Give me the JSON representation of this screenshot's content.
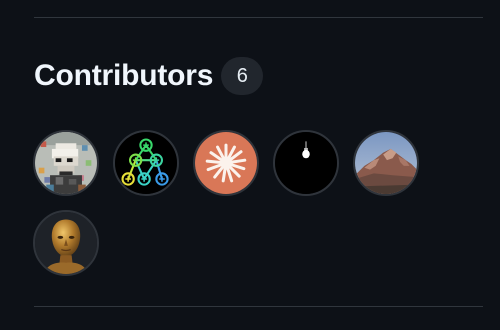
{
  "section": {
    "title": "Contributors",
    "count": "6"
  },
  "contributors": [
    {
      "icon": "pixel-bust-avatar-icon",
      "bg": "#c9ccc6"
    },
    {
      "icon": "neural-network-avatar-icon",
      "bg": "#000000"
    },
    {
      "icon": "starburst-avatar-icon",
      "bg": "#d97757"
    },
    {
      "icon": "lightbulb-avatar-icon",
      "bg": "#000000"
    },
    {
      "icon": "mountain-avatar-icon",
      "bg": "#8aa3c4"
    },
    {
      "icon": "golden-head-avatar-icon",
      "bg": "#1e2228"
    }
  ]
}
